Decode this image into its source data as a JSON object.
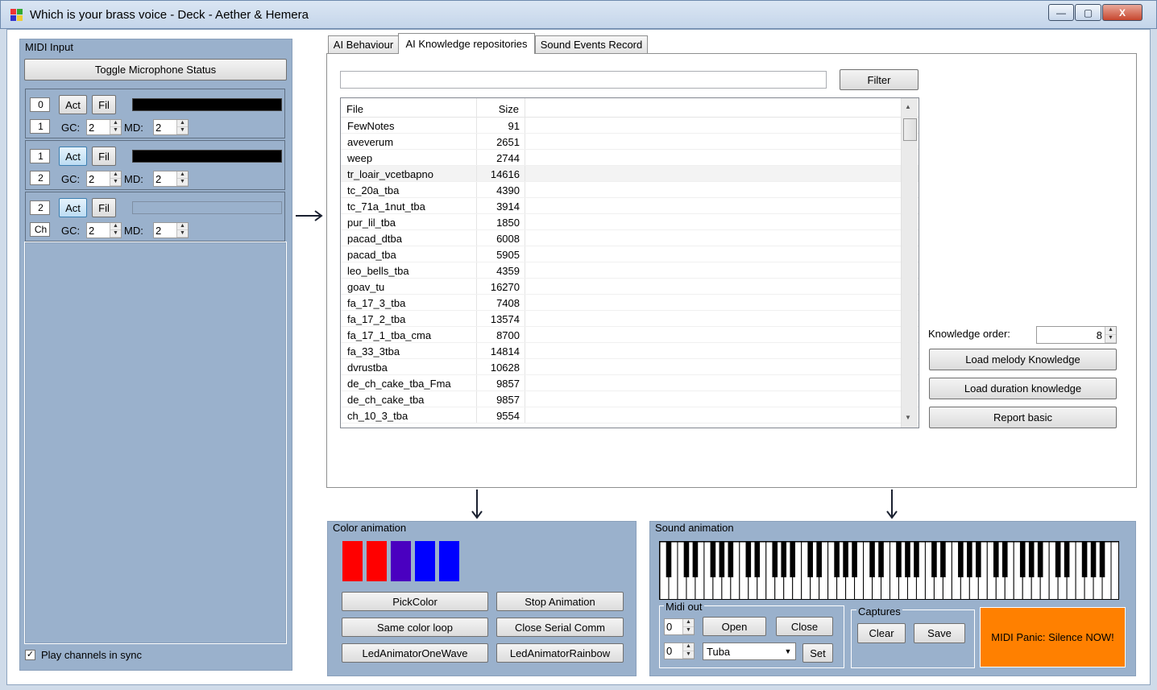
{
  "window": {
    "title": "Which is your brass voice - Deck - Aether & Hemera",
    "minimize_glyph": "—",
    "maximize_glyph": "▢",
    "close_glyph": "X"
  },
  "midi_input": {
    "label": "MIDI Input",
    "toggle_mic_label": "Toggle Microphone Status",
    "play_in_sync_label": "Play channels in sync",
    "play_in_sync_checked": true,
    "channels": [
      {
        "num": "0",
        "sub": "1",
        "act": "Act",
        "fil": "Fil",
        "act_active": false,
        "gc_label": "GC:",
        "gc": "2",
        "md_label": "MD:",
        "md": "2",
        "color": "#000000"
      },
      {
        "num": "1",
        "sub": "2",
        "act": "Act",
        "fil": "Fil",
        "act_active": true,
        "gc_label": "GC:",
        "gc": "2",
        "md_label": "MD:",
        "md": "2",
        "color": "#000000"
      },
      {
        "num": "2",
        "sub": "Ch",
        "act": "Act",
        "fil": "Fil",
        "act_active": true,
        "gc_label": "GC:",
        "gc": "2",
        "md_label": "MD:",
        "md": "2",
        "color": "#9ab1cc"
      }
    ]
  },
  "tabs": [
    {
      "label": "AI Behaviour",
      "selected": false
    },
    {
      "label": "AI Knowledge repositories",
      "selected": true
    },
    {
      "label": "Sound Events Record",
      "selected": false
    }
  ],
  "knowledge": {
    "filter_value": "",
    "filter_label": "Filter",
    "columns": [
      "File",
      "Size"
    ],
    "rows": [
      [
        "FewNotes",
        "91"
      ],
      [
        "aveverum",
        "2651"
      ],
      [
        "weep",
        "2744"
      ],
      [
        "tr_loair_vcetbapno",
        "14616"
      ],
      [
        "tc_20a_tba",
        "4390"
      ],
      [
        "tc_71a_1nut_tba",
        "3914"
      ],
      [
        "pur_lil_tba",
        "1850"
      ],
      [
        "pacad_dtba",
        "6008"
      ],
      [
        "pacad_tba",
        "5905"
      ],
      [
        "leo_bells_tba",
        "4359"
      ],
      [
        "goav_tu",
        "16270"
      ],
      [
        "fa_17_3_tba",
        "7408"
      ],
      [
        "fa_17_2_tba",
        "13574"
      ],
      [
        "fa_17_1_tba_cma",
        "8700"
      ],
      [
        "fa_33_3tba",
        "14814"
      ],
      [
        "dvrustba",
        "10628"
      ],
      [
        "de_ch_cake_tba_Fma",
        "9857"
      ],
      [
        "de_ch_cake_tba",
        "9857"
      ],
      [
        "ch_10_3_tba",
        "9554"
      ]
    ],
    "order_label": "Knowledge order:",
    "order_value": "8",
    "load_melody_label": "Load melody Knowledge",
    "load_duration_label": "Load duration knowledge",
    "report_basic_label": "Report basic"
  },
  "color_animation": {
    "label": "Color animation",
    "swatches": [
      "#ff0000",
      "#ff0000",
      "#4a00c0",
      "#0000ff",
      "#0000ff"
    ],
    "buttons": {
      "pick_color": "PickColor",
      "stop_animation": "Stop Animation",
      "same_color_loop": "Same color loop",
      "close_serial": "Close Serial Comm",
      "one_wave": "LedAnimatorOneWave",
      "rainbow": "LedAnimatorRainbow"
    }
  },
  "sound_animation": {
    "label": "Sound animation",
    "midi_out": {
      "label": "Midi out",
      "port_value": "0",
      "open_label": "Open",
      "close_label": "Close",
      "program_value": "0",
      "instrument": "Tuba",
      "set_label": "Set"
    },
    "captures": {
      "label": "Captures",
      "clear_label": "Clear",
      "save_label": "Save"
    },
    "panic_label": "MIDI Panic: Silence NOW!",
    "panic_color": "#ff8000"
  }
}
